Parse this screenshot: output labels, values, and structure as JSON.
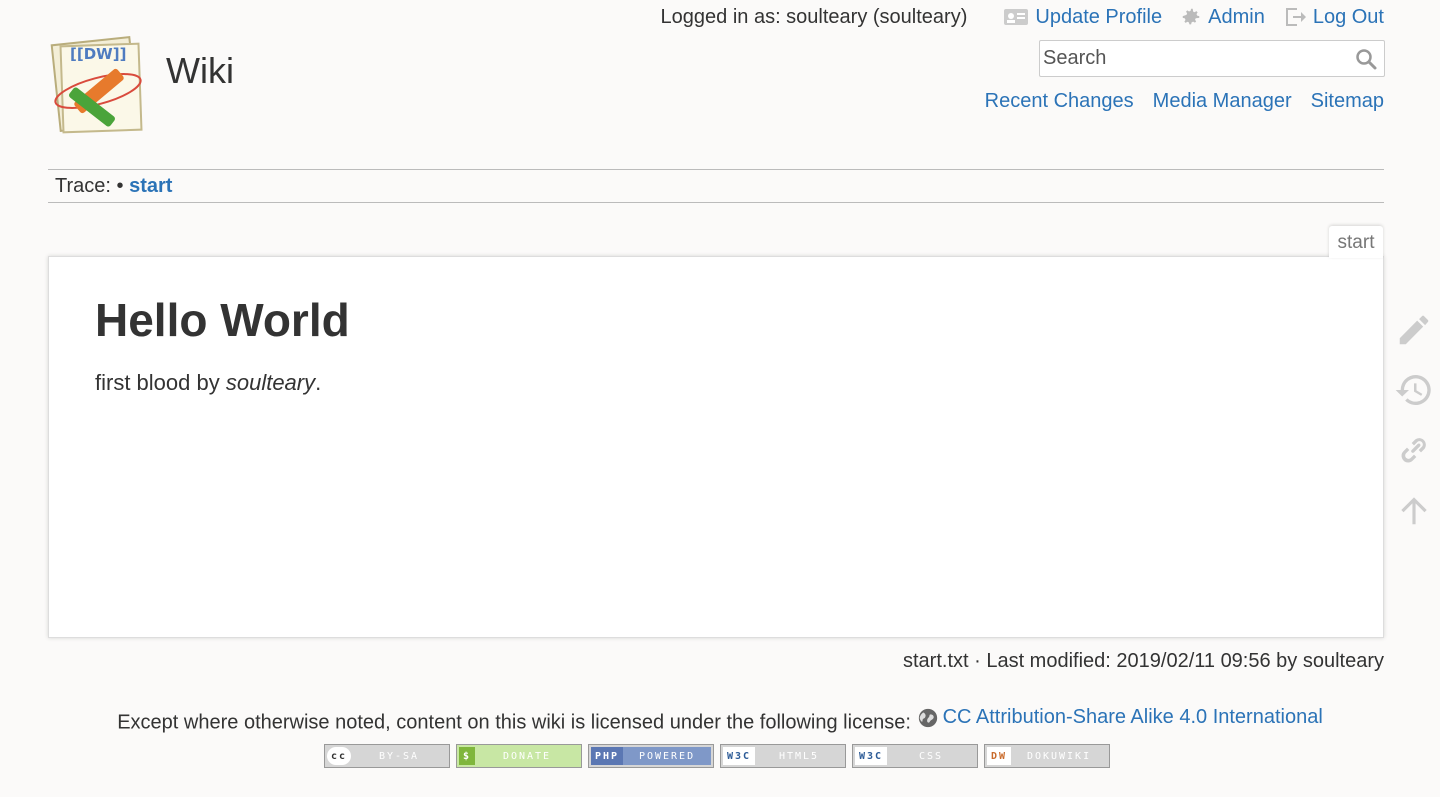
{
  "site": {
    "title": "Wiki",
    "logo_icon": "dokuwiki-logo-icon"
  },
  "usertools": {
    "logged_in_text": "Logged in as: soulteary (soulteary)",
    "update_profile": "Update Profile",
    "admin": "Admin",
    "logout": "Log Out"
  },
  "search": {
    "placeholder": "Search"
  },
  "sitetools": {
    "recent_changes": "Recent Changes",
    "media_manager": "Media Manager",
    "sitemap": "Sitemap"
  },
  "breadcrumbs": {
    "label": "Trace:",
    "separator": "•",
    "crumb": "start"
  },
  "page": {
    "tab": "start",
    "heading": "Hello World",
    "text_before": "first blood by ",
    "text_em": "soulteary",
    "text_after": "."
  },
  "pagetools": [
    "edit-icon",
    "history-icon",
    "link-icon",
    "back-to-top-icon"
  ],
  "docinfo": "start.txt · Last modified: 2019/02/11 09:56 by soulteary",
  "license": {
    "text": "Except where otherwise noted, content on this wiki is licensed under the following license:",
    "link": "CC Attribution-Share Alike 4.0 International"
  },
  "buttons": [
    {
      "left": "cc",
      "right": "BY-SA"
    },
    {
      "left": "$",
      "right": "DONATE"
    },
    {
      "left": "PHP",
      "right": "POWERED"
    },
    {
      "left": "W3C",
      "right": "HTML5"
    },
    {
      "left": "W3C",
      "right": "CSS"
    },
    {
      "left": "DW",
      "right": "DOKUWIKI"
    }
  ],
  "colors": {
    "link": "#2b73b7",
    "text": "#333333",
    "background": "#fbfaf9"
  }
}
